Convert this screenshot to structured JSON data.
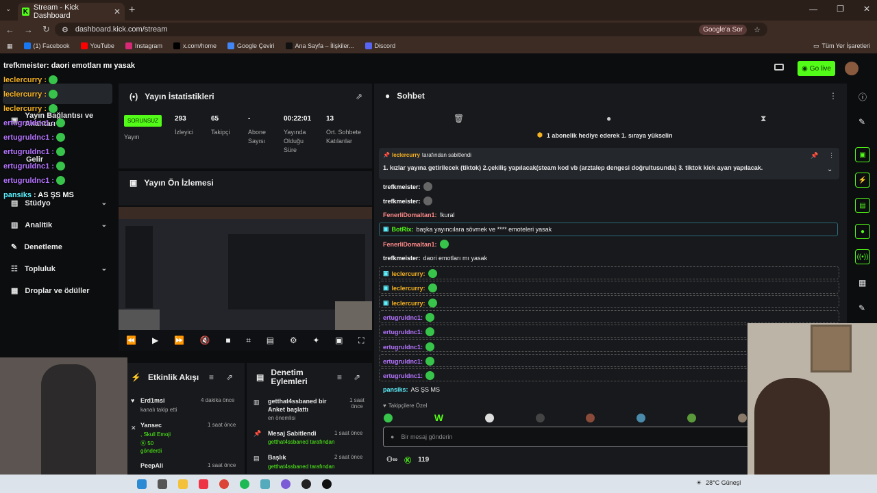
{
  "browser": {
    "tab_title": "Stream - Kick Dashboard",
    "url": "dashboard.kick.com/stream",
    "google_sor": "Google'a Sor",
    "bookmarks": [
      {
        "label": "(1) Facebook",
        "color": "#1877f2"
      },
      {
        "label": "YouTube",
        "color": "#ff0000"
      },
      {
        "label": "Instagram",
        "color": "#d62976"
      },
      {
        "label": "x.com/home",
        "color": "#000000"
      },
      {
        "label": "Google Çeviri",
        "color": "#4285f4"
      },
      {
        "label": "Ana Sayfa – İlişkiler...",
        "color": "#111111"
      },
      {
        "label": "Discord",
        "color": "#5865f2"
      }
    ],
    "all_bookmarks": "Tüm Yer İşaretleri"
  },
  "header": {
    "go_live": "Go live"
  },
  "sidebar": {
    "items": [
      {
        "label": "Yayın Bağlantısı ve Anahtarı"
      },
      {
        "label": "Gelir"
      },
      {
        "label": "Stüdyo"
      },
      {
        "label": "Analitik"
      },
      {
        "label": "Denetleme"
      },
      {
        "label": "Topluluk"
      },
      {
        "label": "Droplar ve ödüller"
      }
    ]
  },
  "overlay": {
    "top": "trefkmeister: daori emotları mı yasak",
    "lines": [
      {
        "user": "leclercurry :",
        "color": "#f6b324"
      },
      {
        "user": "leclercurry :",
        "color": "#f6b324"
      },
      {
        "user": "leclercurry :",
        "color": "#f6b324"
      },
      {
        "user": "ertugruldnc1 :",
        "color": "#b574ff"
      },
      {
        "user": "ertugruldnc1 :",
        "color": "#b574ff"
      },
      {
        "user": "ertugruldnc1 :",
        "color": "#b574ff"
      },
      {
        "user": "ertugruldnc1 :",
        "color": "#b574ff"
      },
      {
        "user": "ertugruldnc1 :",
        "color": "#b574ff"
      }
    ],
    "last_user": "pansiks",
    "last_text": ": AS ŞS MS"
  },
  "stats": {
    "title": "Yayın İstatistikleri",
    "status": "SORUNSUZ",
    "status_label": "Yayın",
    "items": [
      {
        "value": "293",
        "label": "İzleyici"
      },
      {
        "value": "65",
        "label": "Takipçi"
      },
      {
        "value": "-",
        "label": "Abone Sayısı"
      },
      {
        "value": "00:22:01",
        "label": "Yayında Olduğu Süre"
      },
      {
        "value": "13",
        "label": "Ort. Sohbete Katılanlar"
      }
    ]
  },
  "preview": {
    "title": "Yayın Ön İzlemesi"
  },
  "activity": {
    "title": "Etkinlik Akışı",
    "items": [
      {
        "user": "Erd1msi",
        "time": "4 dakika önce",
        "desc": "kanalı takip etti"
      },
      {
        "user": "Yansec",
        "time": "1 saat önce",
        "desc": ", Skull Emoji",
        "amount": "50",
        "extra": "gönderdi"
      },
      {
        "user": "PeepAli",
        "time": "1 saat önce",
        "desc": ""
      }
    ]
  },
  "moderation": {
    "title": "Denetim Eylemleri",
    "items": [
      {
        "title": "getthat4ssbaned bir Anket başlattı",
        "time": "1 saat önce",
        "desc": "en önemlisi"
      },
      {
        "title": "Mesaj Sabitlendi",
        "time": "1 saat önce",
        "desc": "getthat4ssbaned tarafından"
      },
      {
        "title": "Başlık",
        "time": "2 saat önce",
        "desc": "getthat4ssbaned tarafından"
      }
    ]
  },
  "chat": {
    "title": "Sohbet",
    "gift_banner": "1 abonelik hediye ederek 1. sıraya yükselin",
    "pinned_by": "leclercurry",
    "pinned_suffix": "tarafından sabitlendi",
    "pinned_text": "1. kızlar yayına getirilecek (tiktok) 2.çekiliş yapılacak(steam kod vb (arztalep dengesi doğrultusunda) 3. tiktok kick ayarı yapılacak.",
    "messages": [
      {
        "user": "trefkmeister:",
        "color": "#ffffff",
        "text": ""
      },
      {
        "user": "trefkmeister:",
        "color": "#ffffff",
        "text": ""
      },
      {
        "user": "FenerliDomaltan1:",
        "color": "#ff8a8a",
        "text": "!kural"
      },
      {
        "user": "BotRix:",
        "color": "#53fc18",
        "text": "başka yayıncılara sövmek ve **** emoteleri yasak"
      },
      {
        "user": "FenerliDomaltan1:",
        "color": "#ff8a8a",
        "text": ""
      },
      {
        "user": "trefkmeister:",
        "color": "#ffffff",
        "text": "daori emotları mı yasak"
      },
      {
        "user": "leclercurry:",
        "color": "#f6b324",
        "text": ""
      },
      {
        "user": "leclercurry:",
        "color": "#f6b324",
        "text": ""
      },
      {
        "user": "leclercurry:",
        "color": "#f6b324",
        "text": ""
      },
      {
        "user": "ertugruldnc1:",
        "color": "#b574ff",
        "text": ""
      },
      {
        "user": "ertugruldnc1:",
        "color": "#b574ff",
        "text": ""
      },
      {
        "user": "ertugruldnc1:",
        "color": "#b574ff",
        "text": ""
      },
      {
        "user": "ertugruldnc1:",
        "color": "#b574ff",
        "text": ""
      },
      {
        "user": "ertugruldnc1:",
        "color": "#b574ff",
        "text": ""
      },
      {
        "user": "pansiks:",
        "color": "#5ef2ff",
        "text": "AS ŞS MS"
      }
    ],
    "followers_only": "Takipçilere Özel",
    "input_placeholder": "Bir mesaj gönderin",
    "points": "119"
  },
  "taskbar": {
    "weather": "28°C Güneşl"
  }
}
